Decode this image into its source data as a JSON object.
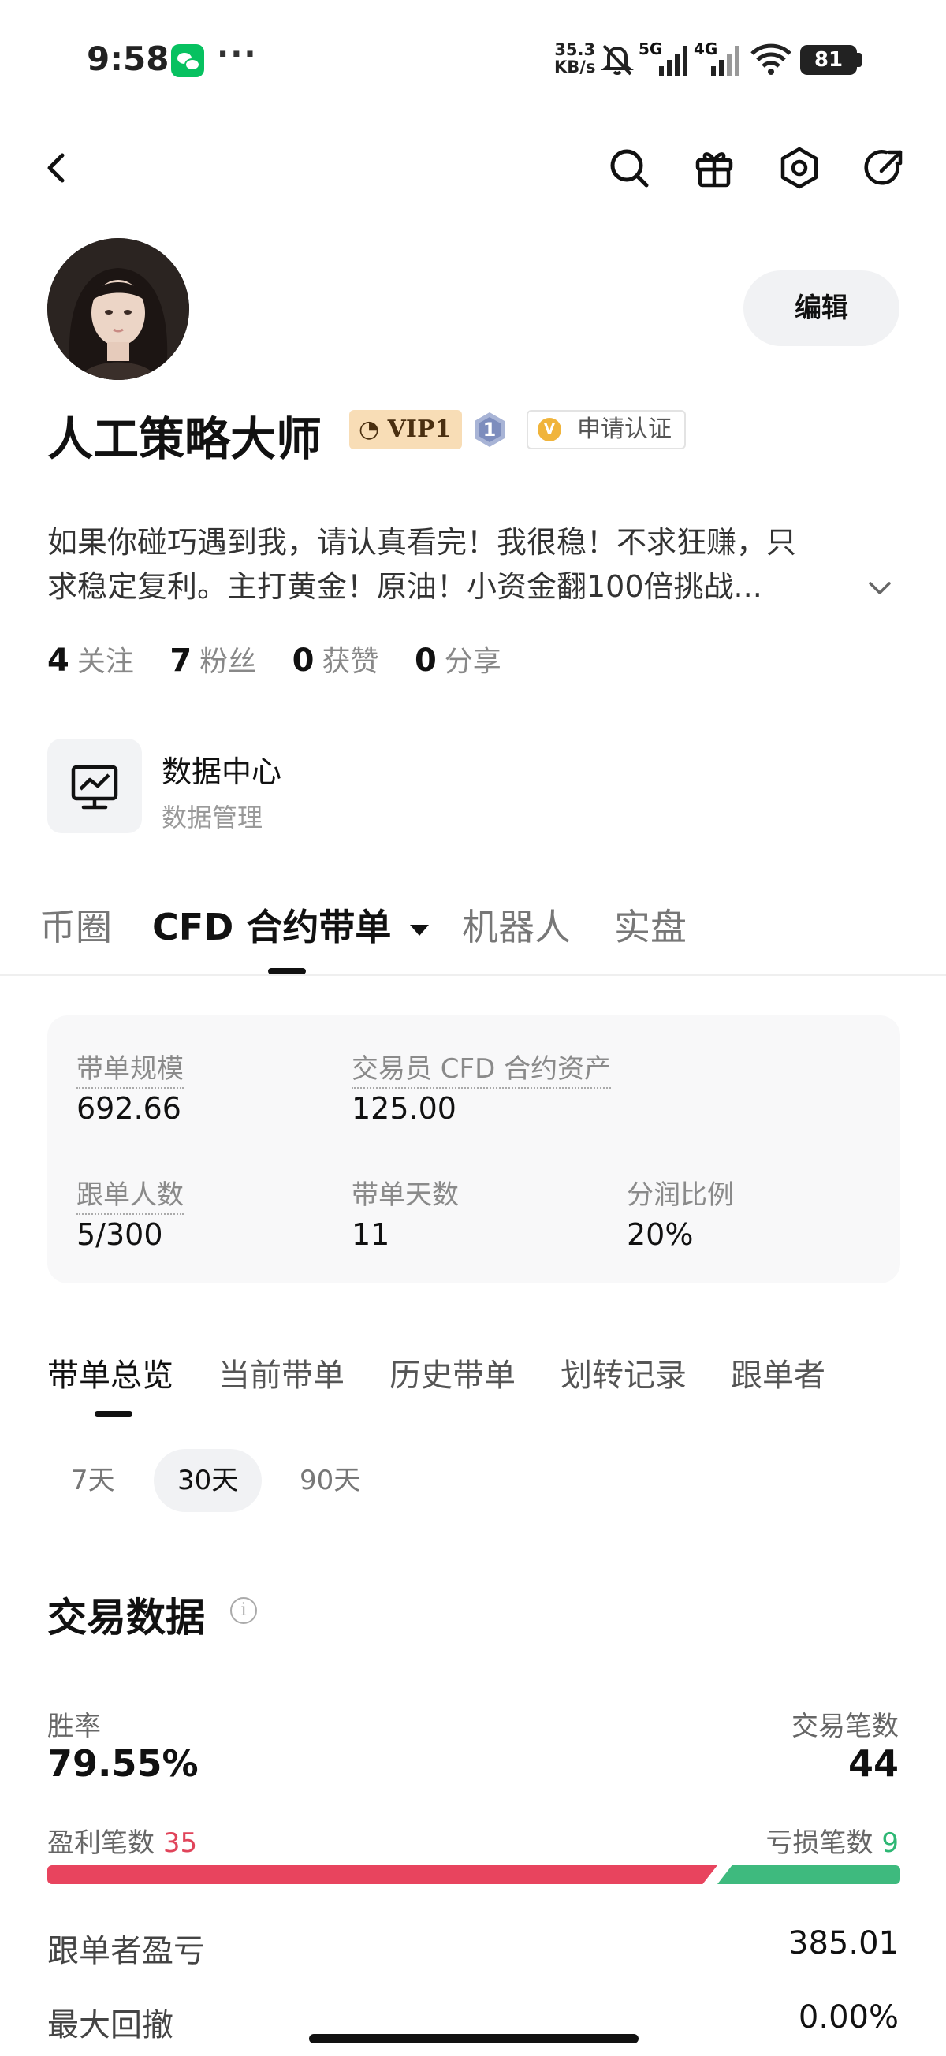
{
  "status_bar": {
    "time": "9:58",
    "dots": "···",
    "net_speed_value": "35.3",
    "net_speed_unit": "KB/s",
    "sig1_label": "5G",
    "sig2_label": "4G",
    "battery": "81"
  },
  "profile": {
    "edit_label": "编辑",
    "name": "人工策略大师",
    "vip_label": "VIP1",
    "level": "1",
    "verify_badge": "V",
    "verify_label": "申请认证",
    "bio_line1": "如果你碰巧遇到我，请认真看完！我很稳！不求狂赚，只",
    "bio_line2": "求稳定复利。主打黄金！原油！小资金翻100倍挑战..."
  },
  "stats": [
    {
      "count": "4",
      "label": "关注"
    },
    {
      "count": "7",
      "label": "粉丝"
    },
    {
      "count": "0",
      "label": "获赞"
    },
    {
      "count": "0",
      "label": "分享"
    }
  ],
  "data_center": {
    "title": "数据中心",
    "subtitle": "数据管理"
  },
  "main_tabs": [
    "币圈",
    "CFD 合约带单",
    "机器人",
    "实盘"
  ],
  "summary": {
    "scale_label": "带单规模",
    "scale_value": "692.66",
    "asset_label": "交易员 CFD 合约资产",
    "asset_value": "125.00",
    "followers_label": "跟单人数",
    "followers_value": "5/300",
    "days_label": "带单天数",
    "days_value": "11",
    "share_label": "分润比例",
    "share_value": "20%"
  },
  "sub_tabs": [
    "带单总览",
    "当前带单",
    "历史带单",
    "划转记录",
    "跟单者"
  ],
  "ranges": [
    "7天",
    "30天",
    "90天"
  ],
  "trade_data": {
    "title": "交易数据",
    "info_icon": "i",
    "win_rate_label": "胜率",
    "win_rate_value": "79.55%",
    "trades_label": "交易笔数",
    "trades_value": "44",
    "profit_label": "盈利笔数",
    "profit_count": "35",
    "loss_label": "亏损笔数",
    "loss_count": "9",
    "follower_pnl_label": "跟单者盈亏",
    "follower_pnl_value": "385.01",
    "max_drawdown_label": "最大回撤",
    "max_drawdown_value": "0.00%"
  },
  "colors": {
    "win": "#e0445a",
    "loss": "#2eb774",
    "vip_bg": "#f8ddb6",
    "verify_badge": "#f0b43b"
  }
}
